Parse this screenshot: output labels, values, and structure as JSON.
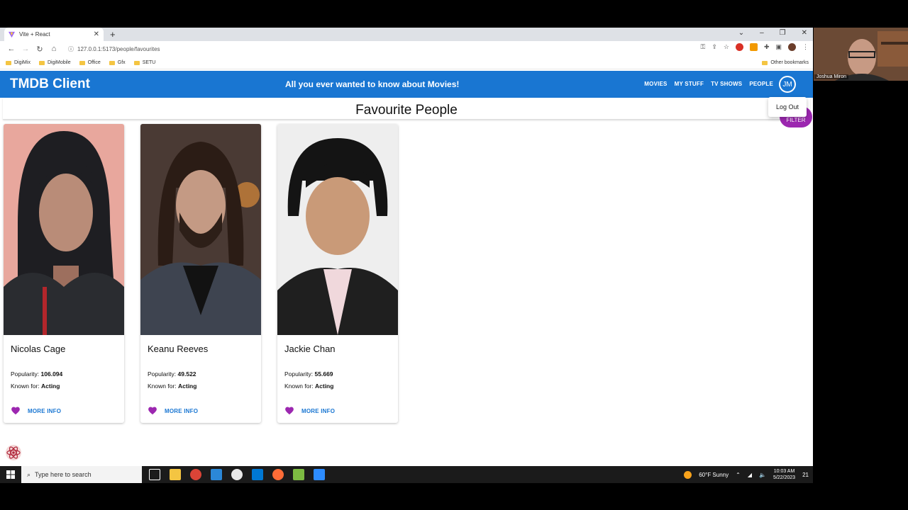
{
  "browser": {
    "tab_title": "Vite + React",
    "url": "127.0.0.1:5173/people/favourites",
    "bookmarks": [
      "DigiMix",
      "DigiMobile",
      "Office",
      "Gfx",
      "SETU"
    ],
    "other_bookmarks": "Other bookmarks"
  },
  "app": {
    "brand": "TMDB Client",
    "tagline": "All you ever wanted to know about Movies!",
    "menu": [
      "MOVIES",
      "MY STUFF",
      "TV SHOWS",
      "PEOPLE"
    ],
    "avatar_initials": "JM",
    "user_menu_item": "Log Out",
    "fab_label": "FILTER",
    "page_title": "Favourite People"
  },
  "people": [
    {
      "name": "Nicolas Cage",
      "popularity_label": "Popularity: ",
      "popularity": "106.094",
      "known_label": "Known for: ",
      "known_for": "Acting",
      "more_info": "MORE INFO"
    },
    {
      "name": "Keanu Reeves",
      "popularity_label": "Popularity: ",
      "popularity": "49.522",
      "known_label": "Known for: ",
      "known_for": "Acting",
      "more_info": "MORE INFO"
    },
    {
      "name": "Jackie Chan",
      "popularity_label": "Popularity: ",
      "popularity": "55.669",
      "known_label": "Known for: ",
      "known_for": "Acting",
      "more_info": "MORE INFO"
    }
  ],
  "taskbar": {
    "search_placeholder": "Type here to search",
    "weather": "60°F  Sunny",
    "time": "10:03 AM",
    "date": "5/22/2023",
    "notifications": "21"
  },
  "webcam": {
    "name": "Joshua Miron"
  },
  "colors": {
    "primary": "#1976d2",
    "accent": "#9c27b0",
    "heart": "#9c27b0"
  }
}
